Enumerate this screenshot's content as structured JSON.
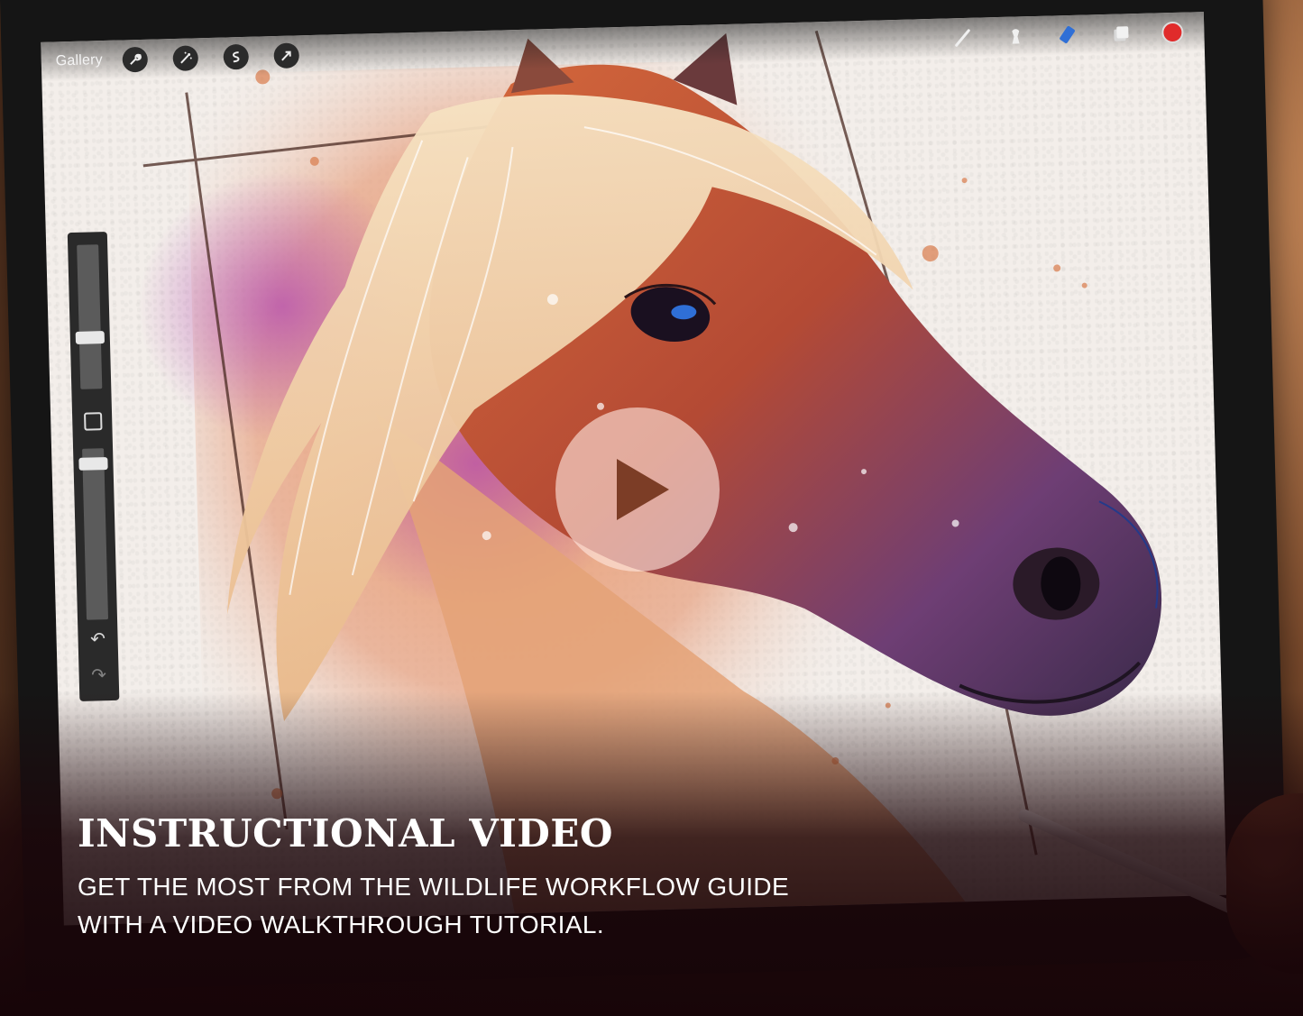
{
  "toolbar": {
    "gallery_label": "Gallery",
    "left_tools": [
      "wrench-icon",
      "magic-wand-icon",
      "selection-icon",
      "transform-arrow-icon"
    ],
    "right_tools": [
      "brush-icon",
      "smudge-icon",
      "eraser-icon",
      "layers-icon"
    ],
    "active_color": "#e02b2b"
  },
  "sidebar": {
    "icons": [
      "modify-square-icon",
      "undo-icon",
      "redo-icon"
    ]
  },
  "video": {
    "play_icon": "play-icon"
  },
  "caption": {
    "title": "INSTRUCTIONAL VIDEO",
    "line1": "GET THE MOST FROM THE WILDLIFE WORKFLOW GUIDE",
    "line2": "WITH A VIDEO WALKTHROUGH TUTORIAL."
  },
  "colors": {
    "accent_blue": "#2f6fd6",
    "caption_bg": "#1c060a"
  }
}
